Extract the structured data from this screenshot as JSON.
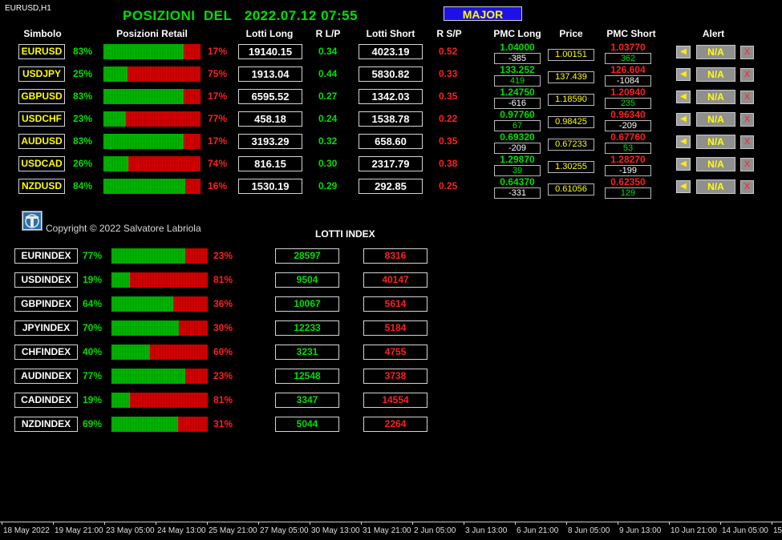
{
  "chart_label": "EURUSD,H1",
  "title": "POSIZIONI  DEL   2022.07.12 07:55",
  "category_button": "MAJOR",
  "headers": {
    "simbolo": "Simbolo",
    "posizioni": "Posizioni Retail",
    "lotti_long": "Lotti Long",
    "r_lp": "R L/P",
    "lotti_short": "Lotti Short",
    "r_sp": "R S/P",
    "pmc_long": "PMC Long",
    "price": "Price",
    "pmc_short": "PMC Short",
    "alert": "Alert"
  },
  "alert_icon": "bell-icon",
  "alert_na_label": "N/A",
  "alert_close_label": "X",
  "pairs": [
    {
      "symbol": "EURUSD",
      "long_pct": "83%",
      "long_frac": 0.83,
      "short_pct": "17%",
      "lotti_long": "19140.15",
      "r_lp": "0.34",
      "lotti_short": "4023.19",
      "r_sp": "0.52",
      "pmc_long": "1.04000",
      "pmc_long_diff": "-385",
      "pmc_long_diff_color": "#ffffff",
      "price": "1.00151",
      "pmc_short": "1.03770",
      "pmc_short_diff": "362",
      "pmc_short_diff_color": "#00e000"
    },
    {
      "symbol": "USDJPY",
      "long_pct": "25%",
      "long_frac": 0.25,
      "short_pct": "75%",
      "lotti_long": "1913.04",
      "r_lp": "0.44",
      "lotti_short": "5830.82",
      "r_sp": "0.33",
      "pmc_long": "133.252",
      "pmc_long_diff": "419",
      "pmc_long_diff_color": "#00e000",
      "price": "137.439",
      "pmc_short": "126.604",
      "pmc_short_diff": "-1084",
      "pmc_short_diff_color": "#ffffff"
    },
    {
      "symbol": "GBPUSD",
      "long_pct": "83%",
      "long_frac": 0.83,
      "short_pct": "17%",
      "lotti_long": "6595.52",
      "r_lp": "0.27",
      "lotti_short": "1342.03",
      "r_sp": "0.35",
      "pmc_long": "1.24750",
      "pmc_long_diff": "-616",
      "pmc_long_diff_color": "#ffffff",
      "price": "1.18590",
      "pmc_short": "1.20940",
      "pmc_short_diff": "235",
      "pmc_short_diff_color": "#00e000"
    },
    {
      "symbol": "USDCHF",
      "long_pct": "23%",
      "long_frac": 0.23,
      "short_pct": "77%",
      "lotti_long": "458.18",
      "r_lp": "0.24",
      "lotti_short": "1538.78",
      "r_sp": "0.22",
      "pmc_long": "0.97760",
      "pmc_long_diff": "67",
      "pmc_long_diff_color": "#00e000",
      "price": "0.98425",
      "pmc_short": "0.96340",
      "pmc_short_diff": "-209",
      "pmc_short_diff_color": "#ffffff"
    },
    {
      "symbol": "AUDUSD",
      "long_pct": "83%",
      "long_frac": 0.83,
      "short_pct": "17%",
      "lotti_long": "3193.29",
      "r_lp": "0.32",
      "lotti_short": "658.60",
      "r_sp": "0.35",
      "pmc_long": "0.69320",
      "pmc_long_diff": "-209",
      "pmc_long_diff_color": "#ffffff",
      "price": "0.67233",
      "pmc_short": "0.67760",
      "pmc_short_diff": "53",
      "pmc_short_diff_color": "#00e000"
    },
    {
      "symbol": "USDCAD",
      "long_pct": "26%",
      "long_frac": 0.26,
      "short_pct": "74%",
      "lotti_long": "816.15",
      "r_lp": "0.30",
      "lotti_short": "2317.79",
      "r_sp": "0.38",
      "pmc_long": "1.29870",
      "pmc_long_diff": "39",
      "pmc_long_diff_color": "#00e000",
      "price": "1.30255",
      "pmc_short": "1.28270",
      "pmc_short_diff": "-199",
      "pmc_short_diff_color": "#ffffff"
    },
    {
      "symbol": "NZDUSD",
      "long_pct": "84%",
      "long_frac": 0.84,
      "short_pct": "16%",
      "lotti_long": "1530.19",
      "r_lp": "0.29",
      "lotti_short": "292.85",
      "r_sp": "0.25",
      "pmc_long": "0.64370",
      "pmc_long_diff": "-331",
      "pmc_long_diff_color": "#ffffff",
      "price": "0.61056",
      "pmc_short": "0.62350",
      "pmc_short_diff": "129",
      "pmc_short_diff_color": "#00e000"
    }
  ],
  "logo_icon": "author-logo-icon",
  "copyright": "Copyright © 2022 Salvatore Labriola",
  "lotti_index_title": "LOTTI INDEX",
  "indices": [
    {
      "symbol": "EURINDEX",
      "long_pct": "77%",
      "long_frac": 0.77,
      "short_pct": "23%",
      "lotti_long": "28597",
      "lotti_short": "8316"
    },
    {
      "symbol": "USDINDEX",
      "long_pct": "19%",
      "long_frac": 0.19,
      "short_pct": "81%",
      "lotti_long": "9504",
      "lotti_short": "40147"
    },
    {
      "symbol": "GBPINDEX",
      "long_pct": "64%",
      "long_frac": 0.64,
      "short_pct": "36%",
      "lotti_long": "10067",
      "lotti_short": "5614"
    },
    {
      "symbol": "JPYINDEX",
      "long_pct": "70%",
      "long_frac": 0.7,
      "short_pct": "30%",
      "lotti_long": "12233",
      "lotti_short": "5184"
    },
    {
      "symbol": "CHFINDEX",
      "long_pct": "40%",
      "long_frac": 0.4,
      "short_pct": "60%",
      "lotti_long": "3231",
      "lotti_short": "4755"
    },
    {
      "symbol": "AUDINDEX",
      "long_pct": "77%",
      "long_frac": 0.77,
      "short_pct": "23%",
      "lotti_long": "12548",
      "lotti_short": "3738"
    },
    {
      "symbol": "CADINDEX",
      "long_pct": "19%",
      "long_frac": 0.19,
      "short_pct": "81%",
      "lotti_long": "3347",
      "lotti_short": "14554"
    },
    {
      "symbol": "NZDINDEX",
      "long_pct": "69%",
      "long_frac": 0.69,
      "short_pct": "31%",
      "lotti_long": "5044",
      "lotti_short": "2264"
    }
  ],
  "time_axis": [
    "18 May 2022",
    "19 May 21:00",
    "23 May 05:00",
    "24 May 13:00",
    "25 May 21:00",
    "27 May 05:00",
    "30 May 13:00",
    "31 May 21:00",
    "2 Jun 05:00",
    "3 Jun 13:00",
    "6 Jun 21:00",
    "8 Jun 05:00",
    "9 Jun 13:00",
    "10 Jun 21:00",
    "14 Jun 05:00",
    "15"
  ],
  "colors": {
    "positive": "#00e000",
    "negative": "#ff2020",
    "symbol": "#ffff00",
    "price": "#ffff00",
    "major_button": "#1e10e6"
  }
}
